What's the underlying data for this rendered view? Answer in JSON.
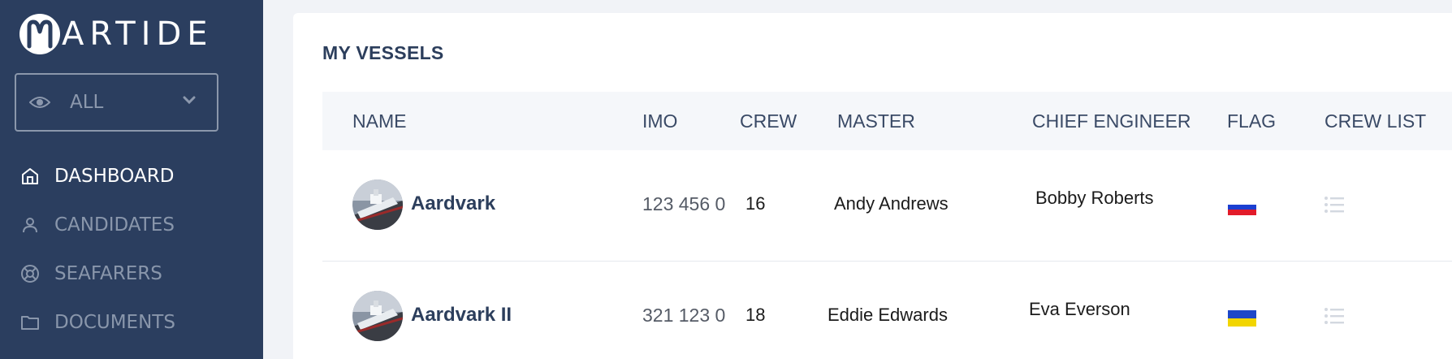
{
  "app": {
    "logo_text": "ARTIDE",
    "logo_initial": "M"
  },
  "filter": {
    "selected": "ALL",
    "icon": "eye-icon"
  },
  "nav": [
    {
      "label": "DASHBOARD",
      "icon": "home-icon",
      "active": true
    },
    {
      "label": "CANDIDATES",
      "icon": "user-icon",
      "active": false
    },
    {
      "label": "SEAFARERS",
      "icon": "lifebuoy-icon",
      "active": false
    },
    {
      "label": "DOCUMENTS",
      "icon": "folder-icon",
      "active": false
    }
  ],
  "main": {
    "title": "MY VESSELS",
    "columns": {
      "name": "NAME",
      "imo": "IMO",
      "crew": "CREW",
      "master": "MASTER",
      "chief_engineer": "CHIEF ENGINEER",
      "flag": "FLAG",
      "crew_list": "CREW LIST"
    },
    "rows": [
      {
        "name": "Aardvark",
        "imo": "123 456 0",
        "crew": "16",
        "master": "Andy Andrews",
        "chief_engineer": "Bobby Roberts",
        "flag": "Russia",
        "flag_colors": [
          "#ffffff",
          "#1b3fd1",
          "#e21b2a"
        ]
      },
      {
        "name": "Aardvark II",
        "imo": "321 123 0",
        "crew": "18",
        "master": "Eddie Edwards",
        "chief_engineer": "Eva Everson",
        "flag": "Ukraine",
        "flag_colors": [
          "#1e47c8",
          "#f2d500"
        ]
      }
    ]
  },
  "colors": {
    "sidebar": "#2b3e5f",
    "accent_text": "#2c3e5c",
    "background": "#f1f3f7"
  }
}
